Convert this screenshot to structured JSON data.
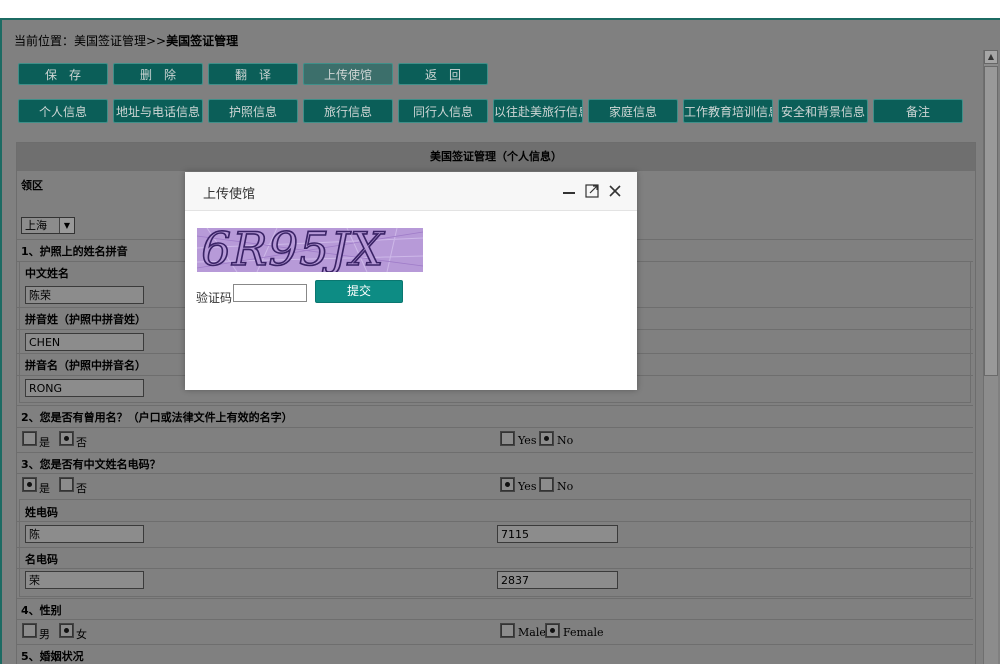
{
  "breadcrumb": {
    "prefix": "当前位置：美国签证管理>>",
    "current": "美国签证管理"
  },
  "toolbar": [
    {
      "label": "保　存"
    },
    {
      "label": "删　除"
    },
    {
      "label": "翻　译"
    },
    {
      "label": "上传使馆"
    },
    {
      "label": "返　回"
    }
  ],
  "tabs": [
    {
      "label": "个人信息"
    },
    {
      "label": "地址与电话信息"
    },
    {
      "label": "护照信息"
    },
    {
      "label": "旅行信息"
    },
    {
      "label": "同行人信息"
    },
    {
      "label": "以往赴美旅行信息"
    },
    {
      "label": "家庭信息"
    },
    {
      "label": "工作教育培训信息"
    },
    {
      "label": "安全和背景信息"
    },
    {
      "label": "备注"
    }
  ],
  "form": {
    "header": "美国签证管理（个人信息）",
    "consulate_label": "领区",
    "consulate_value": "上海",
    "q1": "1、护照上的姓名拼音",
    "chinese_name_label": "中文姓名",
    "chinese_name_value": "陈荣",
    "surname_pinyin_label": "拼音姓（护照中拼音姓）",
    "surname_pinyin_value": "CHEN",
    "given_pinyin_label": "拼音名（护照中拼音名）",
    "given_pinyin_value": "RONG",
    "q2": "2、您是否有曾用名？（户口或法律文件上有效的名字）",
    "q2_yes": "是",
    "q2_no": "否",
    "q2_yes_en": "Yes",
    "q2_no_en": "No",
    "q3": "3、您是否有中文姓名电码？",
    "q3_yes": "是",
    "q3_no": "否",
    "q3_yes_en": "Yes",
    "q3_no_en": "No",
    "surname_code_label": "姓电码",
    "surname_code_cn": "陈",
    "surname_code_value": "7115",
    "given_code_label": "名电码",
    "given_code_cn": "荣",
    "given_code_value": "2837",
    "q4": "4、性别",
    "gender_male": "男",
    "gender_female": "女",
    "gender_male_en": "Male",
    "gender_female_en": "Female",
    "q5": "5、婚姻状况"
  },
  "modal": {
    "title": "上传使馆",
    "captcha_text": "6R95JX",
    "captcha_label": "验证码:",
    "captcha_input": "",
    "submit": "提交"
  },
  "colors": {
    "button_bg": "#0b5e58",
    "overlay": "#808080",
    "submit_bg": "#0d8c84",
    "captcha_bg": "#b79ad8"
  }
}
